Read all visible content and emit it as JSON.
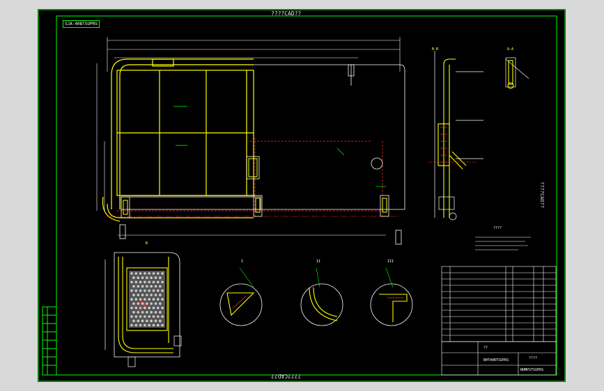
{
  "sheet": {
    "top_title": "????CAD??",
    "bottom_title": "????CAD??",
    "right_title": "????CAD??",
    "drawing_no": "SJA-40BTSUPRS"
  },
  "views": {
    "section_bb": "B-B",
    "section_aa": "A-A",
    "view_b": "B",
    "notes_title": "????",
    "detail_labels": [
      "I",
      "II",
      "III"
    ]
  },
  "title_block": {
    "company": "????",
    "part_no": "NHMPSTSUPRS",
    "material": "??",
    "name_row": "BHT40BTSUPRS"
  },
  "colors": {
    "sheet_bg": "#000000",
    "frame": "#00ff00",
    "outline": "#ffffff",
    "part": "#ffff00",
    "hidden": "#ff3030",
    "centerline": "#ff2020"
  }
}
